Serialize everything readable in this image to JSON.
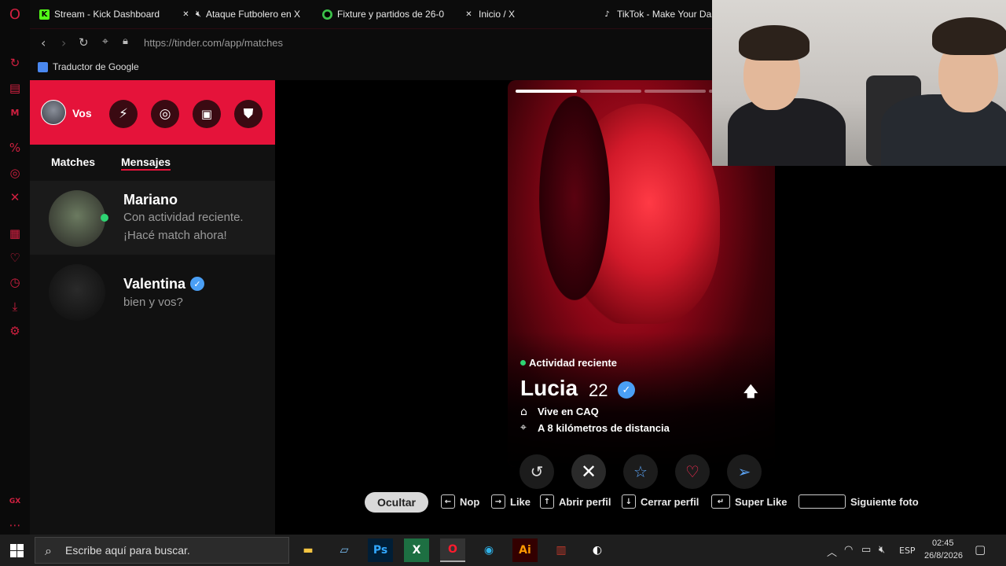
{
  "browser": {
    "tabs": [
      {
        "label": "Stream - Kick Dashboard",
        "favicon": "kick-icon",
        "color": "#53fc18"
      },
      {
        "label": "Ataque Futbolero en X",
        "favicon": "x-icon",
        "color": "#ffffff"
      },
      {
        "label": "Fixture y partidos de 26-0",
        "favicon": "globe-icon",
        "color": "#3cc24a"
      },
      {
        "label": "Inicio / X",
        "favicon": "x-icon",
        "color": "#ffffff"
      },
      {
        "label": "TikTok - Make Your Da",
        "favicon": "tiktok-icon",
        "color": "#ffffff"
      }
    ],
    "url": "https://tinder.com/app/matches",
    "bookmark": "Traductor de Google"
  },
  "tinder": {
    "header": {
      "user_label": "Vos",
      "accent": "#e5133a"
    },
    "tabs": {
      "matches": "Matches",
      "messages": "Mensajes"
    },
    "conversations": [
      {
        "name": "Mariano",
        "preview_line1": "Con actividad reciente.",
        "preview_line2": "¡Hacé match ahora!",
        "online": true
      },
      {
        "name": "Valentina",
        "preview_line1": "bien y vos?",
        "verified": true
      }
    ],
    "card": {
      "activity": "Actividad reciente",
      "name": "Lucia",
      "age": "22",
      "verified": true,
      "lives_in": "Vive en CAQ",
      "distance": "A 8 kilómetros de distancia",
      "photo_count": 4,
      "current_photo": 1
    },
    "shortcuts": {
      "hide": "Ocultar",
      "nope": "Nop",
      "like": "Like",
      "open_profile": "Abrir perfil",
      "close_profile": "Cerrar perfil",
      "super_like": "Super Like",
      "next_photo": "Siguiente foto"
    }
  },
  "taskbar": {
    "search_placeholder": "Escribe aquí para buscar.",
    "language": "ESP",
    "time": "02:45",
    "date": "26/8/2026"
  }
}
